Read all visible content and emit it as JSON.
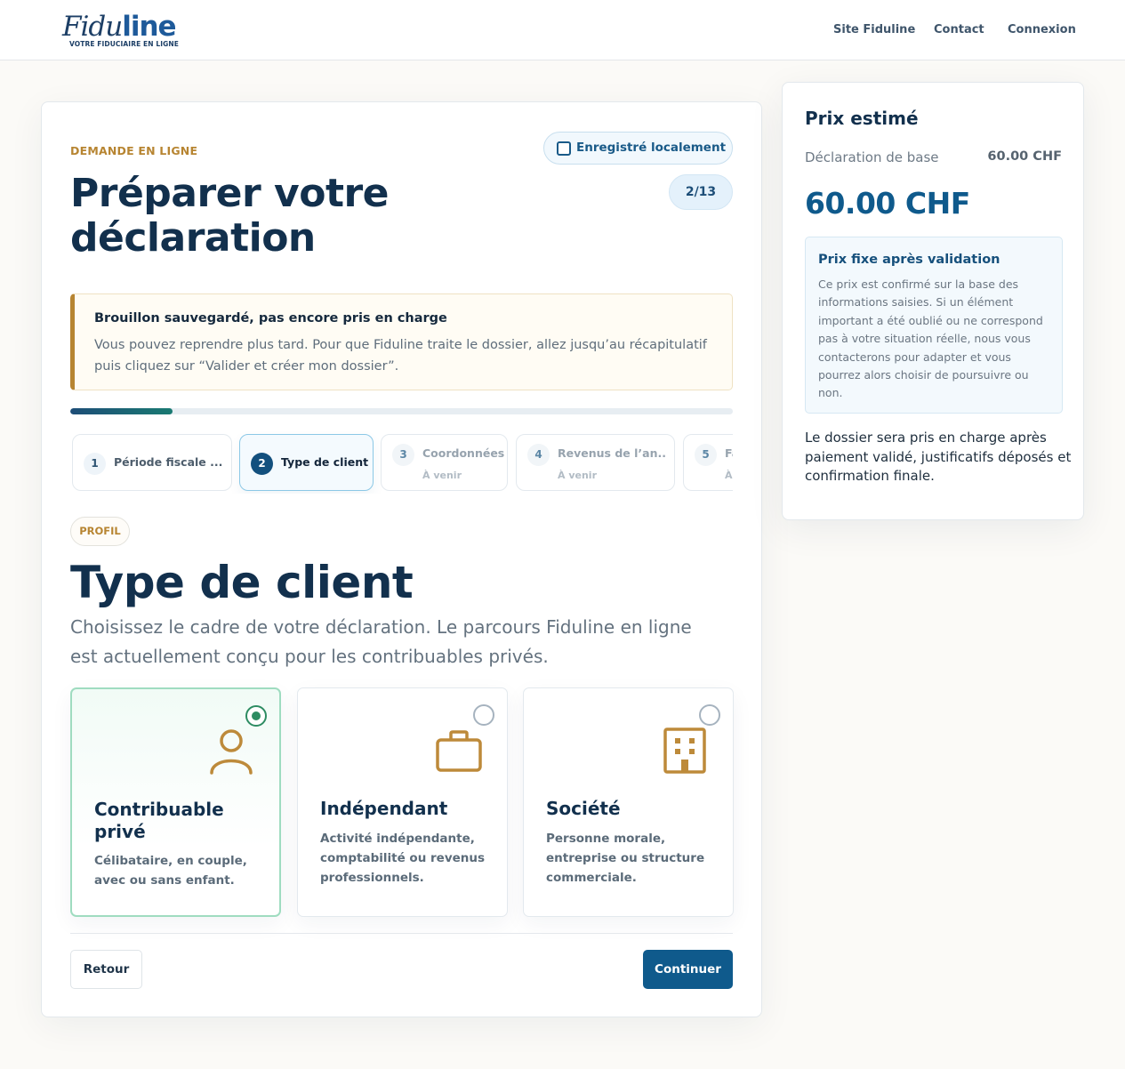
{
  "header": {
    "logo": {
      "text_italic": "Fidu",
      "text_bold": "line",
      "tagline": "VOTRE FIDUCIAIRE EN LIGNE"
    },
    "nav": [
      "Site Fiduline",
      "Contact",
      "Connexion"
    ]
  },
  "form": {
    "eyebrow": "DEMANDE EN LIGNE",
    "title": "Préparer votre déclaration",
    "saved_label": "Enregistré localement",
    "step_counter": "2/13",
    "notice": {
      "title": "Brouillon sauvegardé, pas encore pris en charge",
      "body": "Vous pouvez reprendre plus tard. Pour que Fiduline traite le dossier, allez jusqu’au récapitulatif puis cliquez sur “Valider et créer mon dossier”."
    },
    "progress": 0.154,
    "steps": [
      {
        "num": "1",
        "label": "Période fiscale ...",
        "sub": ""
      },
      {
        "num": "2",
        "label": "Type de client",
        "sub": ""
      },
      {
        "num": "3",
        "label": "Coordonnées",
        "sub": "À venir"
      },
      {
        "num": "4",
        "label": "Revenus de l’an...",
        "sub": "À venir"
      },
      {
        "num": "5",
        "label": "Fa",
        "sub": "À"
      }
    ],
    "section_tag": "PROFIL",
    "section_title": "Type de client",
    "section_desc": "Choisissez le cadre de votre déclaration. Le parcours Fiduline en ligne est actuellement conçu pour les contribuables privés.",
    "options": [
      {
        "title": "Contribuable privé",
        "desc": "Célibataire, en couple, avec ou sans enfant.",
        "icon": "person-icon",
        "selected": true
      },
      {
        "title": "Indépendant",
        "desc": "Activité indépendante, comptabilité ou revenus professionnels.",
        "icon": "briefcase-icon",
        "selected": false
      },
      {
        "title": "Société",
        "desc": "Personne morale, entreprise ou structure commerciale.",
        "icon": "building-icon",
        "selected": false
      }
    ],
    "back_label": "Retour",
    "next_label": "Continuer"
  },
  "price": {
    "title": "Prix estimé",
    "base_label": "Déclaration de base",
    "base_value": "60.00 CHF",
    "total": "60.00 CHF",
    "fixed_title": "Prix fixe après validation",
    "fixed_body": "Ce prix est confirmé sur la base des informations saisies. Si un élément important a été oublié ou ne correspond pas à votre situation réelle, nous vous contacterons pour adapter et vous pourrez alors choisir de poursuivre ou non.",
    "footer": "Le dossier sera pris en charge après paiement validé, justificatifs déposés et confirmation finale."
  },
  "colors": {
    "accent": "#0f5a8c",
    "gold": "#b78532",
    "selected": "#2d8c62"
  }
}
